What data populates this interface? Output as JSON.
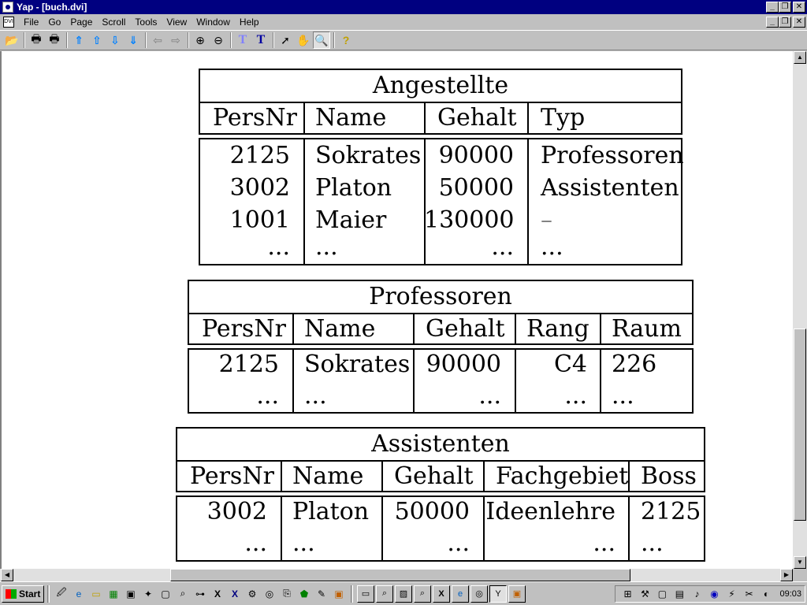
{
  "window": {
    "title": "Yap - [buch.dvi]",
    "controls": {
      "minimize": "_",
      "restore": "❐",
      "close": "✕"
    },
    "doc_controls": {
      "minimize": "_",
      "restore": "❐",
      "close": "✕"
    },
    "doc_icon": "DVI"
  },
  "menu": [
    "File",
    "Go",
    "Page",
    "Scroll",
    "Tools",
    "View",
    "Window",
    "Help"
  ],
  "toolbar": {
    "icons": [
      "open-icon",
      "print-icon",
      "print-setup-icon",
      "first-page-icon",
      "prev-page-icon",
      "next-page-icon",
      "last-page-icon",
      "back-icon",
      "forward-icon",
      "zoom-in-icon",
      "zoom-out-icon",
      "font-outline-icon",
      "font-icon",
      "arrow-cursor-icon",
      "hand-icon",
      "magnifier-icon",
      "help-icon"
    ]
  },
  "tables": {
    "angestellte": {
      "title": "Angestellte",
      "headers": [
        "PersNr",
        "Name",
        "Gehalt",
        "Typ"
      ],
      "rows": [
        [
          "2125",
          "Sokrates",
          "90000",
          "Professoren"
        ],
        [
          "3002",
          "Platon",
          "50000",
          "Assistenten"
        ],
        [
          "1001",
          "Maier",
          "130000",
          "–"
        ],
        [
          "...",
          "...",
          "...",
          "..."
        ]
      ]
    },
    "professoren": {
      "title": "Professoren",
      "headers": [
        "PersNr",
        "Name",
        "Gehalt",
        "Rang",
        "Raum"
      ],
      "rows": [
        [
          "2125",
          "Sokrates",
          "90000",
          "C4",
          "226"
        ],
        [
          "...",
          "...",
          "...",
          "...",
          "..."
        ]
      ]
    },
    "assistenten": {
      "title": "Assistenten",
      "headers": [
        "PersNr",
        "Name",
        "Gehalt",
        "Fachgebiet",
        "Boss"
      ],
      "rows": [
        [
          "3002",
          "Platon",
          "50000",
          "Ideenlehre",
          "2125"
        ],
        [
          "...",
          "...",
          "...",
          "...",
          "..."
        ]
      ]
    }
  },
  "taskbar": {
    "start_label": "Start",
    "clock": "09:03"
  }
}
